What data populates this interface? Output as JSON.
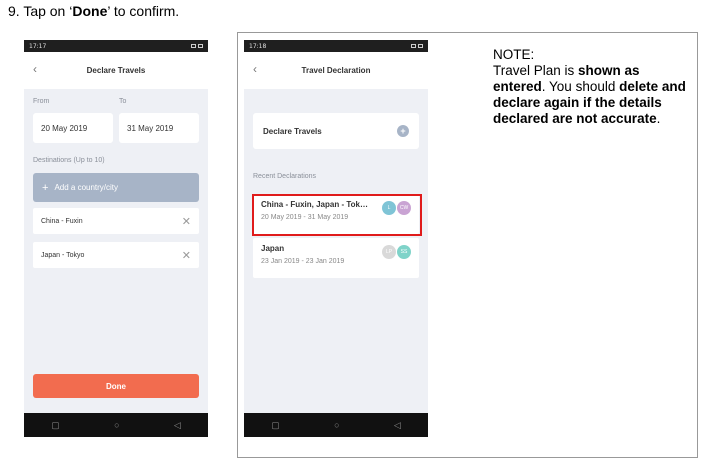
{
  "instruction": {
    "prefix": "9.  Tap on ‘",
    "bold": "Done",
    "suffix": "’ to confirm."
  },
  "phone1": {
    "status_time": "17:17",
    "title": "Declare Travels",
    "from_label": "From",
    "to_label": "To",
    "from_date": "20 May 2019",
    "to_date": "31 May 2019",
    "destinations_label": "Destinations (Up to 10)",
    "add_label": "Add a country/city",
    "destinations": [
      "China - Fuxin",
      "Japan - Tokyo"
    ],
    "done_label": "Done"
  },
  "phone2": {
    "status_time": "17:18",
    "title": "Travel Declaration",
    "declare_label": "Declare Travels",
    "recent_label": "Recent Declarations",
    "recent": [
      {
        "place": "China - Fuxin, Japan - Tok…",
        "dates": "20 May 2019 - 31 May 2019",
        "avatars": [
          {
            "t": "L",
            "c": "#7fc4d6"
          },
          {
            "t": "CW",
            "c": "#c9a3d3"
          }
        ]
      },
      {
        "place": "Japan",
        "dates": "23 Jan 2019 - 23 Jan 2019",
        "avatars": [
          {
            "t": "LP",
            "c": "#d9d9d9"
          },
          {
            "t": "SS",
            "c": "#7fd3c9"
          }
        ]
      }
    ]
  },
  "note": {
    "heading": "NOTE:",
    "l1": "Travel Plan is ",
    "l1b": "shown as entered",
    "l2": ". You should ",
    "l2b": "delete and declare again if the details declared are not accurate",
    "l3": "."
  }
}
